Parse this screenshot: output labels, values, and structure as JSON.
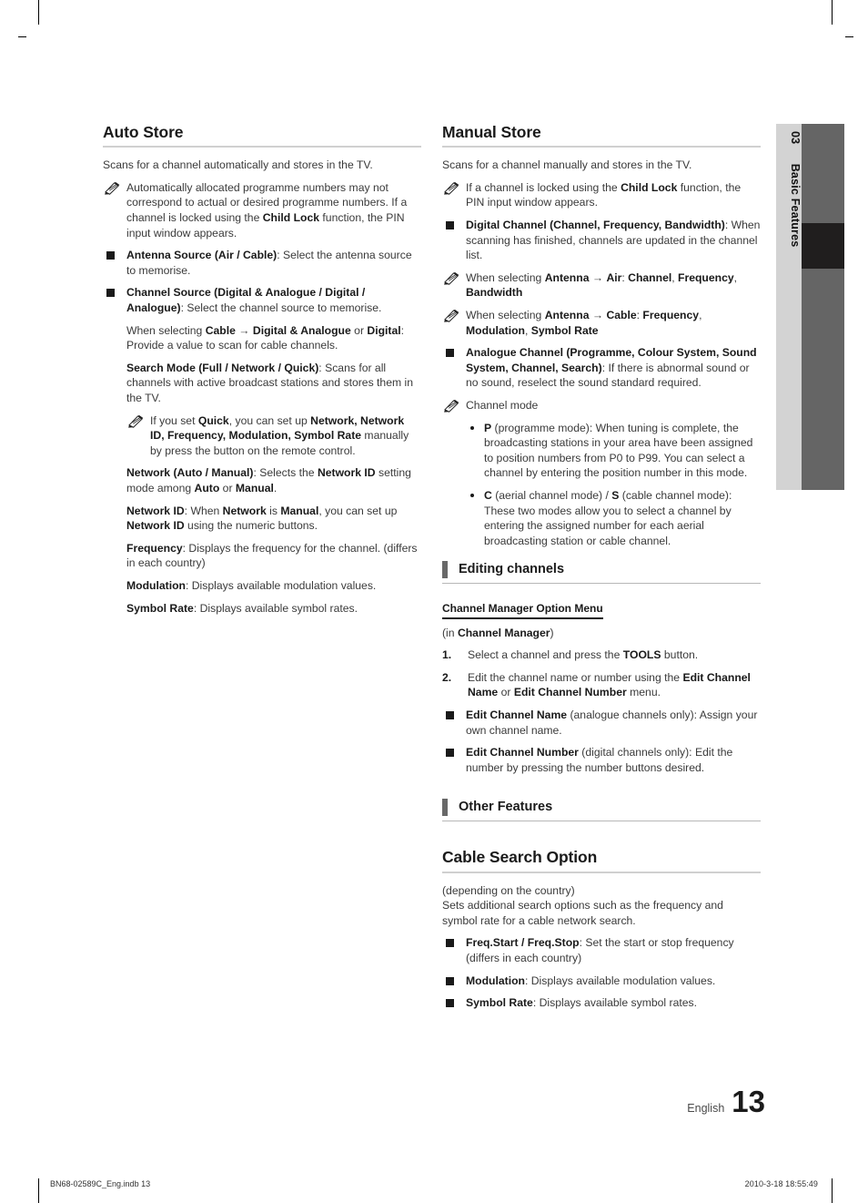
{
  "page": {
    "number": "13",
    "language_label": "English",
    "side_tab_number": "03",
    "side_tab_label": "Basic Features"
  },
  "print_footer": {
    "file": "BN68-02589C_Eng.indb   13",
    "timestamp": "2010-3-18   18:55:49"
  },
  "left_column": {
    "heading": "Auto Store",
    "intro": "Scans for a channel automatically and stores in the TV.",
    "note_1_a": "Automatically allocated programme numbers may not correspond to actual or desired programme numbers. If a channel is locked using the ",
    "note_1_b": "Child Lock",
    "note_1_c": " function, the PIN input window appears.",
    "item_antenna_title": "Antenna Source (Air / Cable)",
    "item_antenna_body": ": Select the antenna source to memorise.",
    "item_chansrc_title": "Channel Source (Digital & Analogue / Digital / Analogue)",
    "item_chansrc_body": ": Select the channel source to memorise.",
    "cable_line_a": "When selecting ",
    "cable_line_b": "Cable",
    "cable_line_c": " → ",
    "cable_line_d": "Digital & Analogue",
    "cable_line_e": " or ",
    "cable_line_f": "Digital",
    "cable_line_g": ": Provide a value to scan for cable channels.",
    "search_mode_title": "Search Mode (Full / Network / Quick)",
    "search_mode_body": ": Scans for all channels with active broadcast stations and stores them in the TV.",
    "quick_note_a": "If you set ",
    "quick_note_b": "Quick",
    "quick_note_c": ", you can set up ",
    "quick_note_d": "Network, Network ID, Frequency, Modulation, Symbol Rate",
    "quick_note_e": " manually by press the button on the remote control.",
    "network_a": "Network (Auto / Manual)",
    "network_b": ": Selects the ",
    "network_c": "Network ID",
    "network_d": " setting mode among ",
    "network_e": "Auto",
    "network_f": " or ",
    "network_g": "Manual",
    "network_h": ".",
    "networkid_a": "Network ID",
    "networkid_b": ": When ",
    "networkid_c": "Network",
    "networkid_d": " is ",
    "networkid_e": "Manual",
    "networkid_f": ", you can set up ",
    "networkid_g": "Network ID",
    "networkid_h": " using the numeric buttons.",
    "frequency_title": "Frequency",
    "frequency_body": ": Displays the frequency for the channel. (differs in each country)",
    "modulation_title": "Modulation",
    "modulation_body": ": Displays available modulation values.",
    "symbolrate_title": "Symbol Rate",
    "symbolrate_body": ": Displays available symbol rates."
  },
  "right_column": {
    "heading": "Manual Store",
    "intro": "Scans for a channel manually and stores in the TV.",
    "note_lock_a": "If a channel is locked using the ",
    "note_lock_b": "Child Lock",
    "note_lock_c": " function, the PIN input window appears.",
    "item_digital_title": "Digital Channel (Channel, Frequency, Bandwidth)",
    "item_digital_body": ": When scanning has finished, channels are updated in the channel list.",
    "note_air_a": "When selecting ",
    "note_air_b": "Antenna",
    "note_air_c": " → ",
    "note_air_d": "Air",
    "note_air_e": ": ",
    "note_air_f": "Channel",
    "note_air_g": ", ",
    "note_air_h": "Frequency",
    "note_air_i": ", ",
    "note_air_j": "Bandwidth",
    "note_cable_a": "When selecting ",
    "note_cable_b": "Antenna",
    "note_cable_c": " → ",
    "note_cable_d": "Cable",
    "note_cable_e": ": ",
    "note_cable_f": "Frequency",
    "note_cable_g": ", ",
    "note_cable_h": "Modulation",
    "note_cable_i": ", ",
    "note_cable_j": "Symbol Rate",
    "item_analogue_title": "Analogue Channel (Programme, Colour System, Sound System, Channel, Search)",
    "item_analogue_body": ": If there is abnormal sound or no sound, reselect the sound standard required.",
    "note_channel_mode": "Channel mode",
    "dot_p_label": "P",
    "dot_p_body": " (programme mode): When tuning is complete, the broadcasting stations in your area have been assigned to position numbers from P0 to P99. You can select a channel by entering the position number in this mode.",
    "dot_cs_label_1": "C",
    "dot_cs_mid": " (aerial channel mode) / ",
    "dot_cs_label_2": "S",
    "dot_cs_body": " (cable channel mode): These two modes allow you to select a channel by entering the assigned number for each aerial broadcasting station or cable channel.",
    "section_editing": "Editing channels",
    "subhead_cmom": "Channel Manager Option Menu",
    "in_cm_a": "(in ",
    "in_cm_b": "Channel Manager",
    "in_cm_c": ")",
    "step_1_num": "1.",
    "step_1_a": "Select a channel and press the ",
    "step_1_b": "TOOLS",
    "step_1_c": " button.",
    "step_2_num": "2.",
    "step_2_a": "Edit the channel name or number using the ",
    "step_2_b": "Edit Channel Name",
    "step_2_c": " or ",
    "step_2_d": "Edit Channel Number",
    "step_2_e": " menu.",
    "item_ecname_title": "Edit Channel Name",
    "item_ecname_body": " (analogue channels only): Assign your own channel name.",
    "item_ecnum_title": "Edit Channel Number",
    "item_ecnum_body": " (digital channels only): Edit the number by pressing the number buttons desired.",
    "section_other": "Other Features",
    "heading_cable": "Cable Search Option",
    "cable_depends": "(depending on the country)",
    "cable_intro": "Sets additional search options such as the frequency and symbol rate for a cable network search.",
    "item_freq_title": "Freq.Start / Freq.Stop",
    "item_freq_body": ": Set the start or stop frequency (differs in each country)",
    "item_mod_title": "Modulation",
    "item_mod_body": ": Displays available modulation values.",
    "item_sym_title": "Symbol Rate",
    "item_sym_body": ": Displays available symbol rates."
  },
  "colors": {
    "side_tab_bg": "#d3d3d3",
    "side_bar_grey": "#656565",
    "side_bar_black": "#201e1e",
    "heading_rule": "#d0d0d0",
    "section_marker": "#686868"
  }
}
